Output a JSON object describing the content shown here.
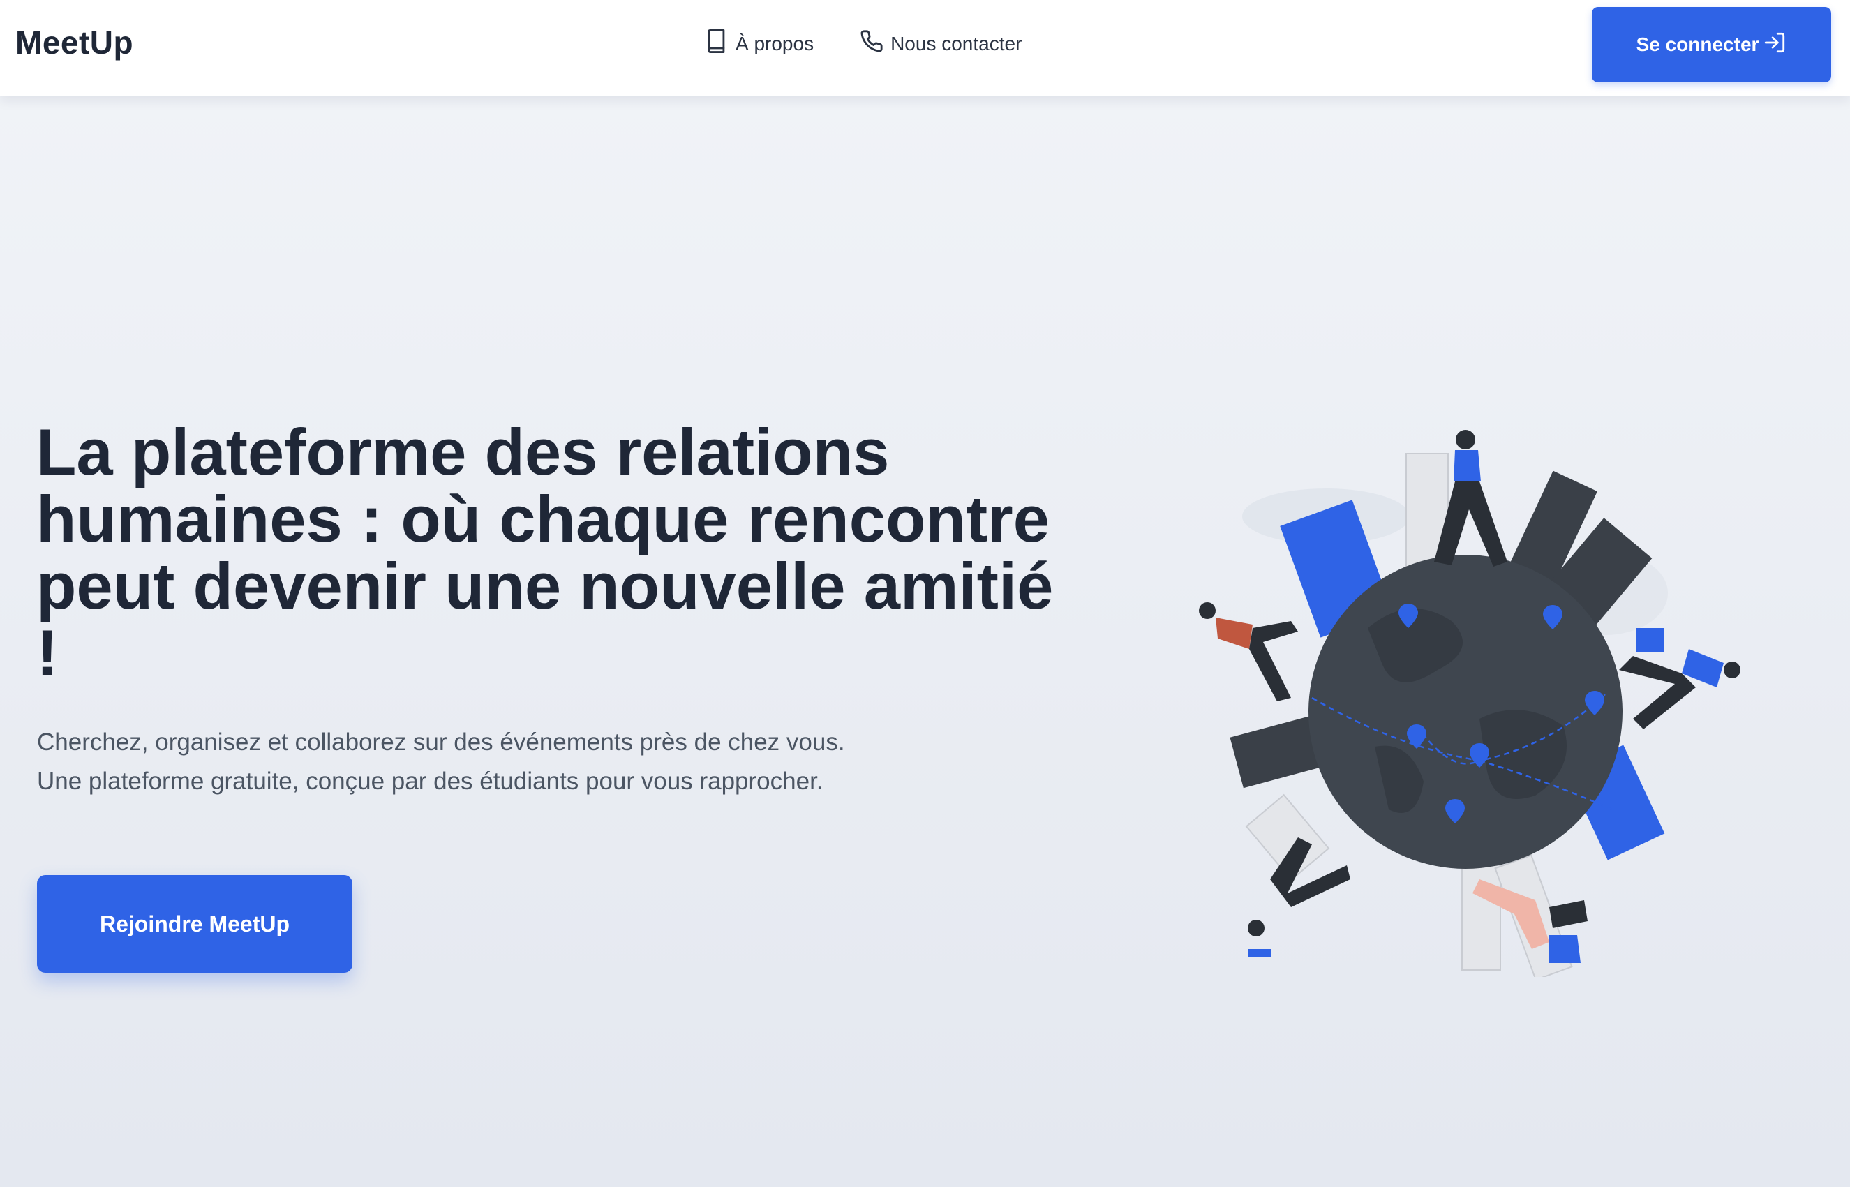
{
  "navbar": {
    "brand": "MeetUp",
    "links": [
      {
        "label": "À propos",
        "icon": "book-icon"
      },
      {
        "label": "Nous contacter",
        "icon": "phone-icon"
      }
    ],
    "login_label": "Se connecter",
    "login_icon": "sign-in-icon"
  },
  "hero": {
    "title": "La plateforme des relations humaines : où chaque rencontre peut devenir une nouvelle amitié !",
    "subtitle": "Cherchez, organisez et collaborez sur des événements près de chez vous. Une plateforme gratuite, conçue par des étudiants pour vous rapprocher.",
    "cta_label": "Rejoindre MeetUp",
    "illustration": "globe-people-illustration"
  },
  "colors": {
    "accent": "#2f63e6",
    "text_dark": "#1f2737",
    "text_muted": "#4b5563",
    "globe": "#3f464f",
    "building_dark": "#3a4048",
    "building_blue": "#2f63e6"
  }
}
